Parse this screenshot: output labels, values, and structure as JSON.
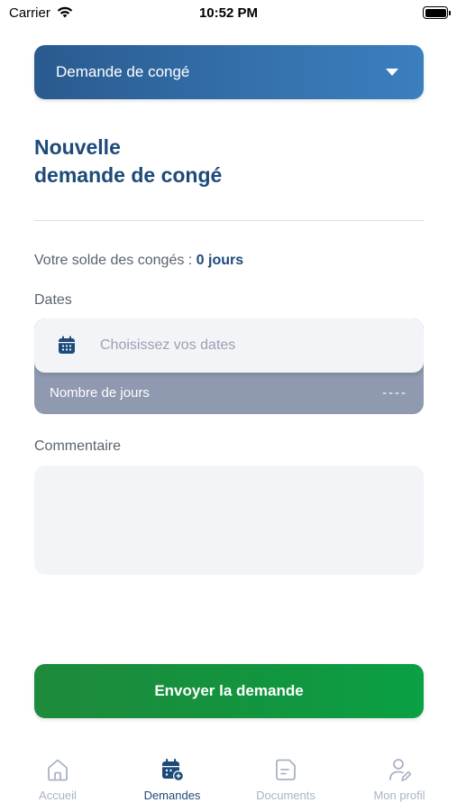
{
  "status_bar": {
    "carrier": "Carrier",
    "time": "10:52 PM"
  },
  "dropdown": {
    "label": "Demande de congé"
  },
  "title": {
    "line1": "Nouvelle",
    "line2": "demande de congé"
  },
  "balance": {
    "label": "Votre solde des congés : ",
    "value": "0 jours"
  },
  "dates": {
    "label": "Dates",
    "placeholder": "Choisissez vos dates",
    "days_label": "Nombre de jours",
    "days_value": "----"
  },
  "comment": {
    "label": "Commentaire",
    "value": ""
  },
  "submit": {
    "label": "Envoyer la demande"
  },
  "tabs": [
    {
      "label": "Accueil",
      "icon": "home-icon",
      "active": false
    },
    {
      "label": "Demandes",
      "icon": "calendar-add-icon",
      "active": true
    },
    {
      "label": "Documents",
      "icon": "document-icon",
      "active": false
    },
    {
      "label": "Mon profil",
      "icon": "user-edit-icon",
      "active": false
    }
  ],
  "colors": {
    "primary": "#1d4a78",
    "dropdown_gradient_start": "#2a5a8f",
    "dropdown_gradient_end": "#3b7fbf",
    "submit_gradient_start": "#1e8a3c",
    "submit_gradient_end": "#0aa044",
    "tab_inactive": "#a8b4c4",
    "days_card": "#8f99af",
    "input_bg": "#f2f4f8"
  }
}
